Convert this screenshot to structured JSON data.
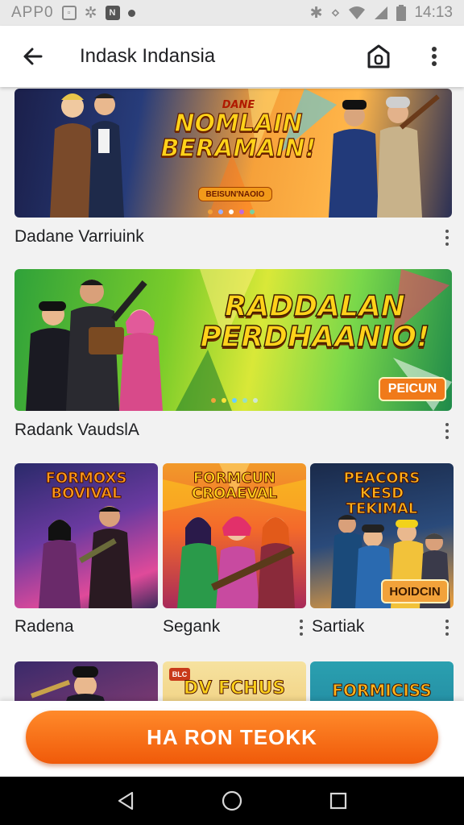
{
  "status_bar": {
    "left_label": "APP0",
    "box_glyph": "N",
    "time": "14:13"
  },
  "app_bar": {
    "title": "Indask Indansia"
  },
  "featured": [
    {
      "banner_title_line1": "DANE",
      "banner_title_line2": "NOMLAIN",
      "banner_title_line3": "BERAMAIN!",
      "banner_button": "BEISUN'NAOIO",
      "caption": "Dadane Varriuink"
    },
    {
      "banner_title_line1": "RADDALAN",
      "banner_title_line2": "PERDHAANIO!",
      "banner_button": "PEICUN",
      "caption": "Radank VaudslA"
    }
  ],
  "grid": [
    {
      "title": "FORMOXS BOVIVAL",
      "caption": "Radena"
    },
    {
      "title": "FORMCUN CROAEVAL",
      "caption": "Segank"
    },
    {
      "title": "PEACORS KESD TEKIMAL",
      "badge": "HOIDCIN",
      "caption": "Sartiak"
    }
  ],
  "grid_row2": [
    {
      "title": ""
    },
    {
      "title": "DV FCHUS",
      "tag": "BLC"
    },
    {
      "title": "FORMICISS"
    }
  ],
  "cta": {
    "label": "HA RON TEOKK"
  },
  "colors": {
    "accent": "#f26a12",
    "title_yellow": "#ffd21a",
    "appbar": "#ffffff"
  },
  "icons": {
    "back": "arrow-left-icon",
    "home": "home-icon",
    "menu": "more-vertical-icon",
    "nav_back": "triangle-back-icon",
    "nav_home": "circle-home-icon",
    "nav_recent": "square-recent-icon"
  }
}
